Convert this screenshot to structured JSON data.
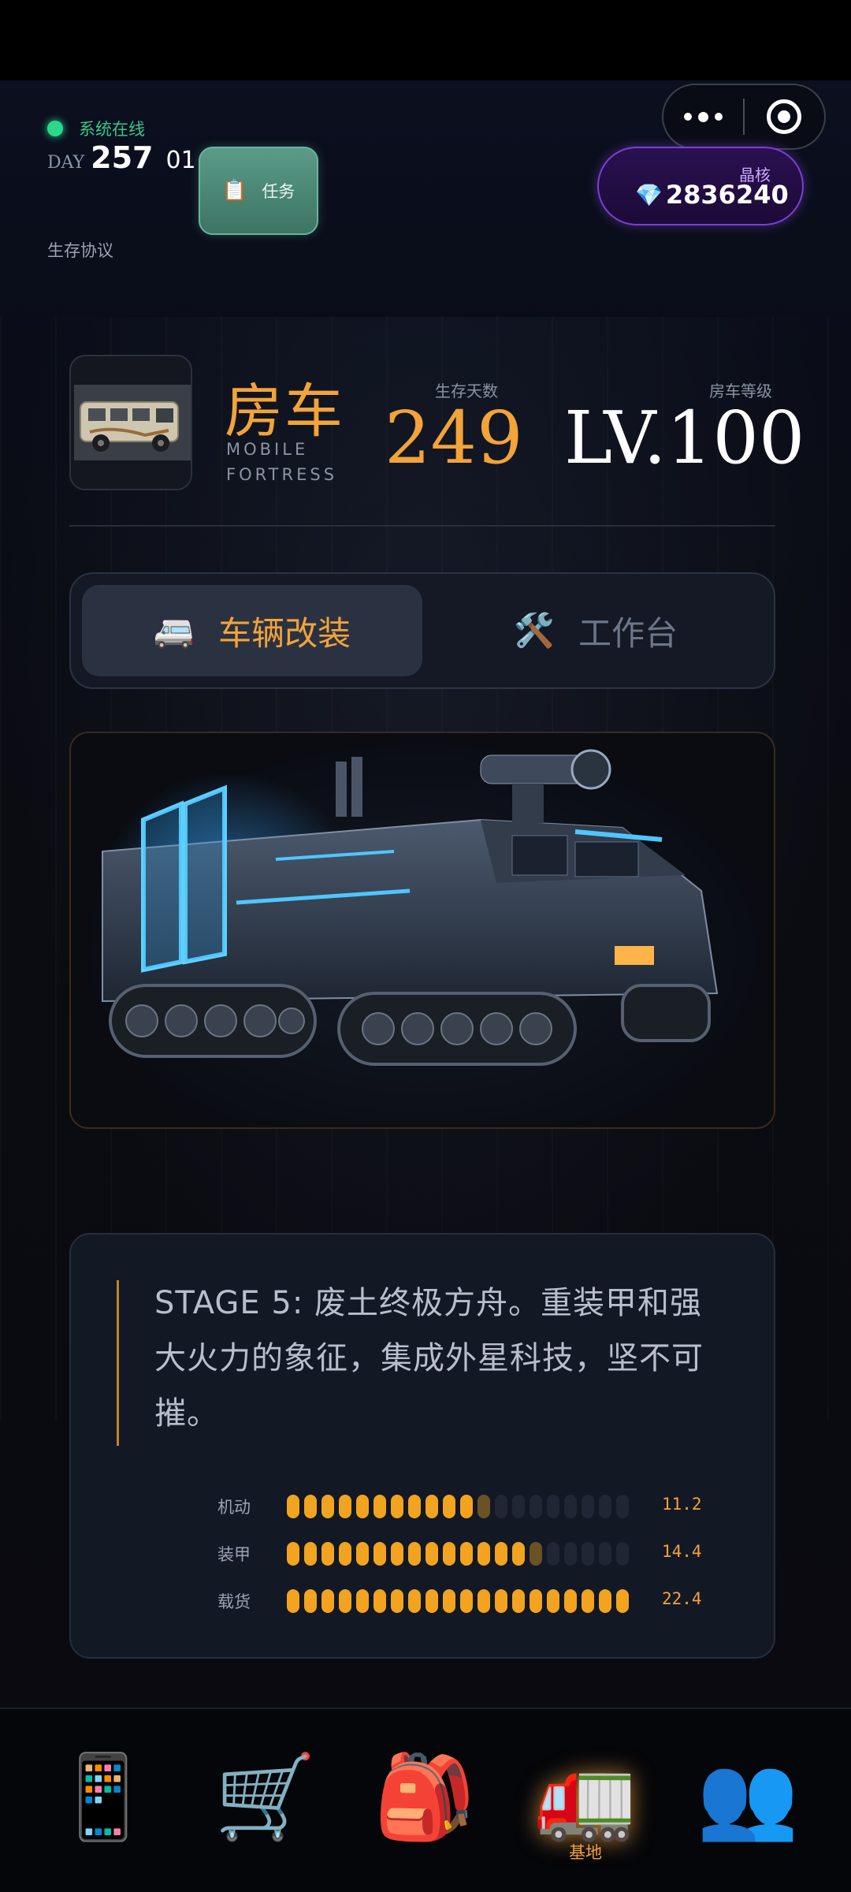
{
  "header": {
    "online_text": "系统在线",
    "day_label": "DAY",
    "day_number": "257",
    "day_sub": "01",
    "protocol": "生存协议",
    "task_label": "任务",
    "crystal_label": "晶核",
    "crystal_value": "2836240"
  },
  "profile": {
    "title": "房车",
    "subtitle": "MOBILE FORTRESS",
    "days_label": "生存天数",
    "days_value": "249",
    "level_label": "房车等级",
    "level_value": "LV.100"
  },
  "tabs": [
    {
      "label": "车辆改装",
      "icon": "van-icon",
      "active": true
    },
    {
      "label": "工作台",
      "icon": "tools-icon",
      "active": false
    }
  ],
  "description": "STAGE 5: 废土终极方舟。重装甲和强大火力的象征，集成外星科技，坚不可摧。",
  "stats": [
    {
      "name": "机动",
      "value": "11.2",
      "filled": 11,
      "partial": true,
      "total": 20
    },
    {
      "name": "装甲",
      "value": "14.4",
      "filled": 14,
      "partial": true,
      "total": 20
    },
    {
      "name": "载货",
      "value": "22.4",
      "filled": 20,
      "partial": false,
      "total": 20
    }
  ],
  "nav": [
    {
      "name": "phone-icon",
      "label": ""
    },
    {
      "name": "cart-icon",
      "label": ""
    },
    {
      "name": "backpack-icon",
      "label": ""
    },
    {
      "name": "truck-icon",
      "label": "基地",
      "active": true
    },
    {
      "name": "people-icon",
      "label": ""
    }
  ],
  "colors": {
    "accent": "#f2a33a",
    "online": "#2bd98a",
    "crystal": "#7a3fd6",
    "task": "#4a8a78"
  }
}
